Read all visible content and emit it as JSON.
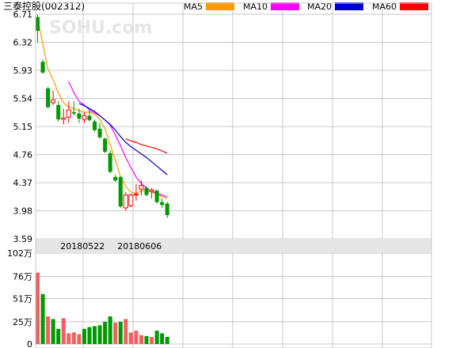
{
  "title": "三泰控股(002312)",
  "watermark": "SOHU.com",
  "legend": [
    {
      "label": "MA5",
      "color": "#ff9900"
    },
    {
      "label": "MA10",
      "color": "#ff00ff"
    },
    {
      "label": "MA20",
      "color": "#0000cc"
    },
    {
      "label": "MA60",
      "color": "#ff0000"
    }
  ],
  "colors": {
    "up": "#ff0000",
    "down": "#009900",
    "up_volume": "#f06060",
    "grid": "#c8c8c8",
    "date_bar": "#e6e6e6"
  },
  "chart_data": [
    {
      "type": "candlestick",
      "ylim": [
        3.59,
        6.71
      ],
      "y_ticks": [
        "6.71",
        "6.32",
        "5.93",
        "5.54",
        "5.15",
        "4.76",
        "4.37",
        "3.98",
        "3.59"
      ],
      "date_labels": [
        {
          "index": 5,
          "label": "20180522"
        },
        {
          "index": 16,
          "label": "20180606"
        }
      ],
      "n_slots": 60,
      "candles": [
        {
          "o": 6.67,
          "h": 6.7,
          "l": 6.32,
          "c": 6.48
        },
        {
          "o": 6.05,
          "h": 6.08,
          "l": 5.88,
          "c": 5.9
        },
        {
          "o": 5.68,
          "h": 5.7,
          "l": 5.4,
          "c": 5.42
        },
        {
          "o": 5.48,
          "h": 5.65,
          "l": 5.45,
          "c": 5.52
        },
        {
          "o": 5.45,
          "h": 5.5,
          "l": 5.22,
          "c": 5.25
        },
        {
          "o": 5.25,
          "h": 5.4,
          "l": 5.18,
          "c": 5.27
        },
        {
          "o": 5.28,
          "h": 5.5,
          "l": 5.2,
          "c": 5.38
        },
        {
          "o": 5.35,
          "h": 5.5,
          "l": 5.3,
          "c": 5.33
        },
        {
          "o": 5.33,
          "h": 5.4,
          "l": 5.2,
          "c": 5.26
        },
        {
          "o": 5.25,
          "h": 5.35,
          "l": 5.2,
          "c": 5.3
        },
        {
          "o": 5.3,
          "h": 5.38,
          "l": 5.22,
          "c": 5.24
        },
        {
          "o": 5.22,
          "h": 5.25,
          "l": 5.08,
          "c": 5.1
        },
        {
          "o": 5.12,
          "h": 5.2,
          "l": 4.98,
          "c": 5.0
        },
        {
          "o": 4.98,
          "h": 5.0,
          "l": 4.78,
          "c": 4.8
        },
        {
          "o": 4.78,
          "h": 4.82,
          "l": 4.5,
          "c": 4.52
        },
        {
          "o": 4.45,
          "h": 4.48,
          "l": 4.38,
          "c": 4.4
        },
        {
          "o": 4.45,
          "h": 4.46,
          "l": 4.02,
          "c": 4.04
        },
        {
          "o": 4.02,
          "h": 4.24,
          "l": 3.98,
          "c": 4.2
        },
        {
          "o": 4.05,
          "h": 4.22,
          "l": 4.03,
          "c": 4.2
        },
        {
          "o": 4.2,
          "h": 4.35,
          "l": 4.12,
          "c": 4.21
        },
        {
          "o": 4.28,
          "h": 4.4,
          "l": 4.2,
          "c": 4.33
        },
        {
          "o": 4.3,
          "h": 4.32,
          "l": 4.18,
          "c": 4.2
        },
        {
          "o": 4.25,
          "h": 4.3,
          "l": 4.15,
          "c": 4.27
        },
        {
          "o": 4.26,
          "h": 4.28,
          "l": 4.08,
          "c": 4.1
        },
        {
          "o": 4.1,
          "h": 4.15,
          "l": 4.02,
          "c": 4.06
        },
        {
          "o": 4.08,
          "h": 4.1,
          "l": 3.88,
          "c": 3.92
        }
      ],
      "ma": {
        "MA5": [
          6.65,
          6.3,
          5.95,
          5.8,
          5.62,
          5.48,
          5.42,
          5.4,
          5.37,
          5.35,
          5.35,
          5.32,
          5.25,
          5.12,
          4.9,
          4.68,
          4.45,
          4.32,
          4.24,
          4.22,
          4.26,
          4.25,
          4.24,
          4.21,
          4.18,
          4.15
        ],
        "MA10": [
          null,
          null,
          null,
          null,
          null,
          null,
          5.78,
          5.62,
          5.5,
          5.45,
          5.38,
          5.34,
          5.3,
          5.24,
          5.17,
          5.03,
          4.88,
          4.72,
          4.58,
          4.45,
          4.36,
          4.3,
          4.25,
          4.22,
          4.2,
          4.17
        ],
        "MA20": [
          null,
          null,
          null,
          null,
          null,
          null,
          null,
          null,
          5.47,
          5.44,
          5.4,
          5.36,
          5.3,
          5.24,
          5.18,
          5.1,
          5.01,
          4.93,
          4.87,
          4.82,
          4.77,
          4.72,
          4.66,
          4.6,
          4.54,
          4.48
        ],
        "MA60": [
          null,
          null,
          null,
          null,
          null,
          null,
          null,
          null,
          null,
          null,
          null,
          null,
          null,
          null,
          null,
          null,
          null,
          4.98,
          4.95,
          4.93,
          4.9,
          4.88,
          4.86,
          4.84,
          4.81,
          4.78
        ]
      }
    },
    {
      "type": "bar",
      "unit": "万",
      "ylim": [
        0,
        102
      ],
      "y_ticks": [
        {
          "value": 102,
          "label": "102万"
        },
        {
          "value": 76,
          "label": "76万"
        },
        {
          "value": 51,
          "label": "51万"
        },
        {
          "value": 25,
          "label": "25万"
        },
        {
          "value": 0,
          "label": "0"
        }
      ],
      "values": [
        80,
        56,
        31,
        28,
        17,
        29,
        12,
        13,
        11,
        17,
        19,
        20,
        21,
        25,
        31,
        24,
        25,
        28,
        13,
        15,
        10,
        9,
        8,
        15,
        12,
        8
      ],
      "direction": [
        "up",
        "down",
        "up",
        "down",
        "down",
        "up",
        "up",
        "up",
        "up",
        "down",
        "down",
        "down",
        "down",
        "down",
        "down",
        "up",
        "down",
        "up",
        "up",
        "up",
        "up",
        "down",
        "up",
        "down",
        "down",
        "down"
      ]
    }
  ]
}
